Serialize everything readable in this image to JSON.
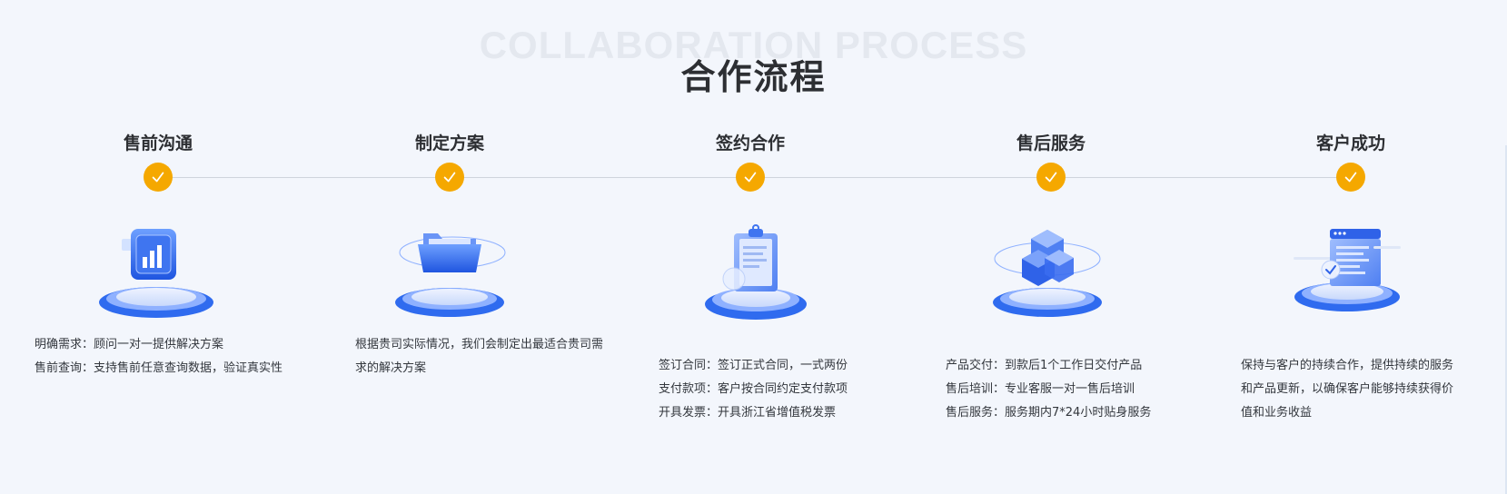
{
  "header": {
    "bg_title": "COLLABORATION PROCESS",
    "title": "合作流程"
  },
  "steps": [
    {
      "title": "售前沟通",
      "lines": [
        "明确需求：顾问一对一提供解决方案",
        "售前查询：支持售前任意查询数据，验证真实性"
      ],
      "illustration": "bar-chart-icon"
    },
    {
      "title": "制定方案",
      "lines": [
        "根据贵司实际情况，我们会制定出最适合贵司需",
        "求的解决方案"
      ],
      "illustration": "folder-icon"
    },
    {
      "title": "签约合作",
      "lines": [
        "签订合同：签订正式合同，一式两份",
        "支付款项：客户按合同约定支付款项",
        "开具发票：开具浙江省增值税发票"
      ],
      "illustration": "clipboard-icon"
    },
    {
      "title": "售后服务",
      "lines": [
        "产品交付：到款后1个工作日交付产品",
        "售后培训：专业客服一对一售后培训",
        "售后服务：服务期内7*24小时贴身服务"
      ],
      "illustration": "cubes-icon"
    },
    {
      "title": "客户成功",
      "lines": [
        "保持与客户的持续合作，提供持续的服务",
        "和产品更新，以确保客户能够持续获得价",
        "值和业务收益"
      ],
      "illustration": "document-check-icon"
    }
  ],
  "colors": {
    "accent": "#f5a800",
    "blue": "#2f6bef",
    "title": "#2d2f33"
  }
}
